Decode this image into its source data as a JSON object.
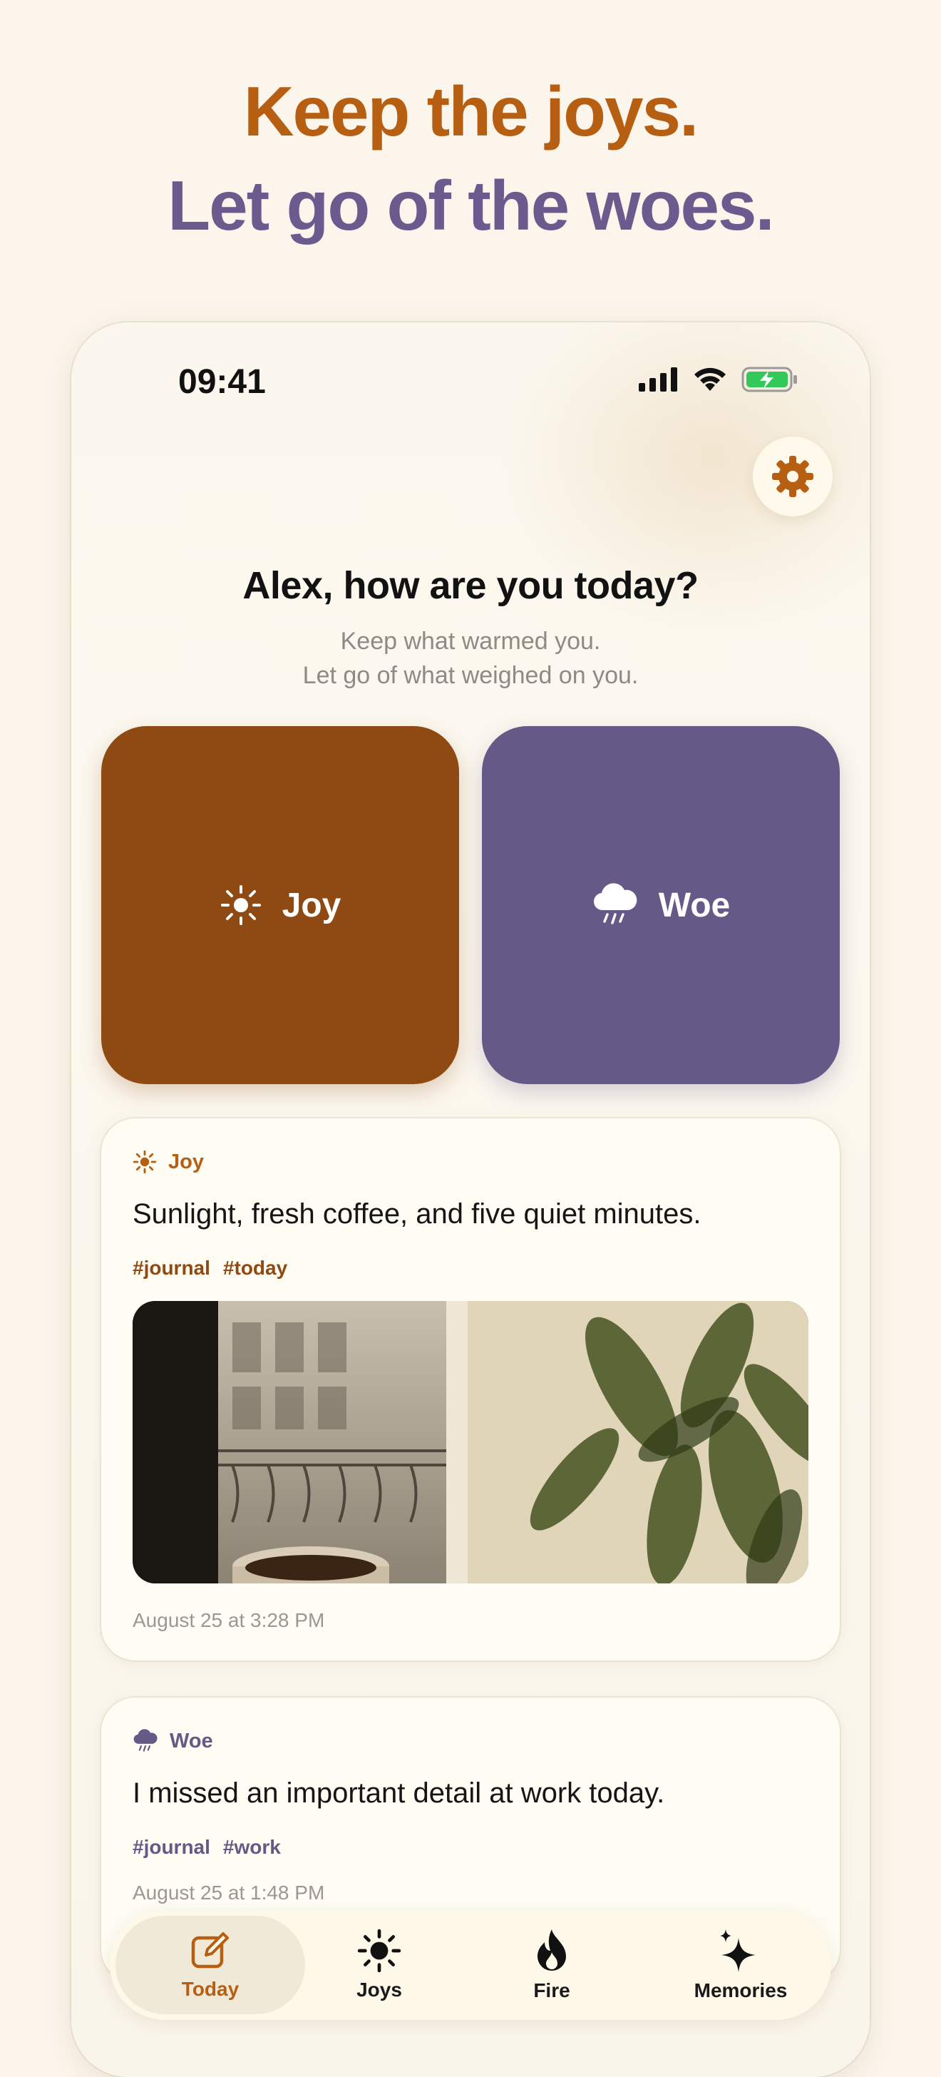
{
  "headline": {
    "line1": "Keep the joys.",
    "line2": "Let go of the woes."
  },
  "colors": {
    "joy": "#8E4A12",
    "woe": "#655987",
    "accent": "#B65F12",
    "background": "#FBF5EB"
  },
  "status_bar": {
    "time": "09:41",
    "icons": [
      "cellular-icon",
      "wifi-icon",
      "battery-charging-icon"
    ]
  },
  "greeting": {
    "title": "Alex, how are you today?",
    "subtitle_line1": "Keep what warmed you.",
    "subtitle_line2": "Let go of what weighed on you."
  },
  "actions": {
    "joy_label": "Joy",
    "woe_label": "Woe"
  },
  "entries": [
    {
      "type": "Joy",
      "text": "Sunlight, fresh coffee, and five quiet minutes.",
      "tags": [
        "#journal",
        "#today"
      ],
      "has_photo": true,
      "date": "August 25 at 3:28 PM"
    },
    {
      "type": "Woe",
      "text": "I missed an important detail at work today.",
      "tags": [
        "#journal",
        "#work"
      ],
      "has_photo": false,
      "date": "August 25 at 1:48 PM"
    }
  ],
  "tabbar": {
    "today": "Today",
    "joys": "Joys",
    "fire": "Fire",
    "memories": "Memories",
    "selected": "Today"
  }
}
